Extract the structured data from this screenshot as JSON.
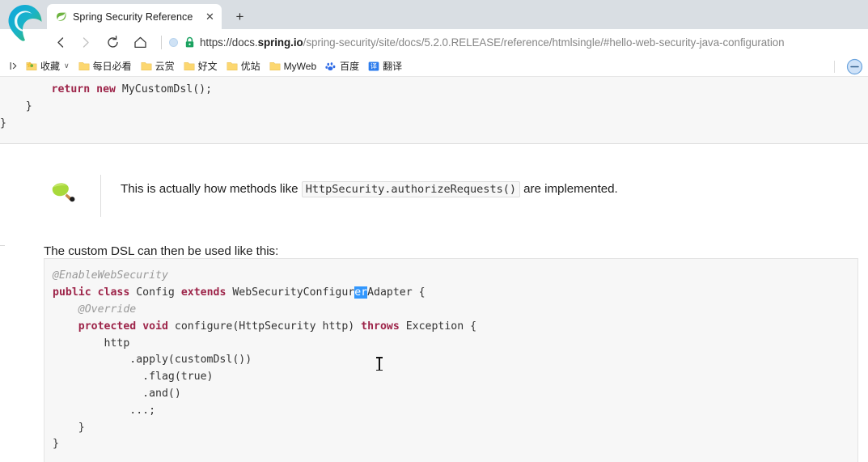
{
  "browser": {
    "app_icon": "edge-logo",
    "tab": {
      "favicon": "spring-leaf-icon",
      "title": "Spring Security Reference",
      "close_label": "✕"
    },
    "new_tab_label": "+",
    "nav": {
      "back_label": "‹",
      "forward_label": "›",
      "reload_label": "↻",
      "home_label": "⌂"
    },
    "address": {
      "permission_icon": "site-info-icon",
      "lock_icon": "lock-icon",
      "scheme": "https://docs.",
      "host_strong": "spring.io",
      "path": "/spring-security/site/docs/5.2.0.RELEASE/reference/htmlsingle/#hello-web-security-java-configuration",
      "full_url": "https://docs.spring.io/spring-security/site/docs/5.2.0.RELEASE/reference/htmlsingle/#hello-web-security-java-configuration"
    },
    "bookmarks": {
      "overflow_label": "|›",
      "items": [
        {
          "label": "收藏",
          "icon": "star-folder-icon",
          "caret": "∨"
        },
        {
          "label": "每日必看",
          "icon": "folder-icon",
          "caret": ""
        },
        {
          "label": "云赏",
          "icon": "folder-icon",
          "caret": ""
        },
        {
          "label": "好文",
          "icon": "folder-icon",
          "caret": ""
        },
        {
          "label": "优站",
          "icon": "folder-icon",
          "caret": ""
        },
        {
          "label": "MyWeb",
          "icon": "folder-icon",
          "caret": ""
        },
        {
          "label": "百度",
          "icon": "baidu-paw-icon",
          "caret": ""
        },
        {
          "label": "翻译",
          "icon": "translate-icon",
          "caret": ""
        }
      ],
      "collapse_icon": "collapse-circle-icon"
    }
  },
  "content": {
    "code_top": {
      "lines": [
        {
          "indent": 8,
          "segments": [
            {
              "text": "return",
              "style": "kw"
            },
            {
              "text": " ",
              "style": ""
            },
            {
              "text": "new",
              "style": "kw"
            },
            {
              "text": " MyCustomDsl();",
              "style": ""
            }
          ]
        },
        {
          "indent": 4,
          "segments": [
            {
              "text": "}",
              "style": ""
            }
          ]
        },
        {
          "indent": 0,
          "segments": [
            {
              "text": "}",
              "style": ""
            }
          ]
        }
      ]
    },
    "tip": {
      "icon": "tip-leaf-pen-icon",
      "text_before": "This is actually how methods like",
      "code": "HttpSecurity.authorizeRequests()",
      "text_after": "are implemented."
    },
    "paragraph": "The custom DSL can then be used like this:",
    "code_main": {
      "lines": [
        {
          "indent": 0,
          "segments": [
            {
              "text": "@EnableWebSecurity",
              "style": "ann"
            }
          ]
        },
        {
          "indent": 0,
          "segments": [
            {
              "text": "public",
              "style": "kw"
            },
            {
              "text": " ",
              "style": ""
            },
            {
              "text": "class",
              "style": "kw"
            },
            {
              "text": " Config ",
              "style": ""
            },
            {
              "text": "extends",
              "style": "kw"
            },
            {
              "text": " WebSecurityConfigur",
              "style": ""
            },
            {
              "text": "er",
              "style": "sel"
            },
            {
              "text": "Adapter {",
              "style": ""
            }
          ]
        },
        {
          "indent": 4,
          "segments": [
            {
              "text": "@Override",
              "style": "ann"
            }
          ]
        },
        {
          "indent": 4,
          "segments": [
            {
              "text": "protected",
              "style": "kw"
            },
            {
              "text": " ",
              "style": ""
            },
            {
              "text": "void",
              "style": "kw"
            },
            {
              "text": " configure(HttpSecurity http) ",
              "style": ""
            },
            {
              "text": "throws",
              "style": "kw"
            },
            {
              "text": " Exception {",
              "style": ""
            }
          ]
        },
        {
          "indent": 8,
          "segments": [
            {
              "text": "http",
              "style": ""
            }
          ]
        },
        {
          "indent": 12,
          "segments": [
            {
              "text": ".apply(customDsl())",
              "style": ""
            }
          ]
        },
        {
          "indent": 14,
          "segments": [
            {
              "text": ".flag(true)",
              "style": ""
            }
          ]
        },
        {
          "indent": 14,
          "segments": [
            {
              "text": ".and()",
              "style": ""
            }
          ]
        },
        {
          "indent": 12,
          "segments": [
            {
              "text": "...;",
              "style": ""
            }
          ]
        },
        {
          "indent": 4,
          "segments": [
            {
              "text": "}",
              "style": ""
            }
          ]
        },
        {
          "indent": 0,
          "segments": [
            {
              "text": "}",
              "style": ""
            }
          ]
        }
      ],
      "selection_text": "er"
    }
  },
  "colors": {
    "keyword": "#9d2449",
    "annotation": "#999999",
    "selection": "#3297fd",
    "code_bg": "#f7f7f7",
    "tabstrip_bg": "#d9dee3",
    "folder": "#fcd770",
    "lock_green": "#1aa260"
  }
}
